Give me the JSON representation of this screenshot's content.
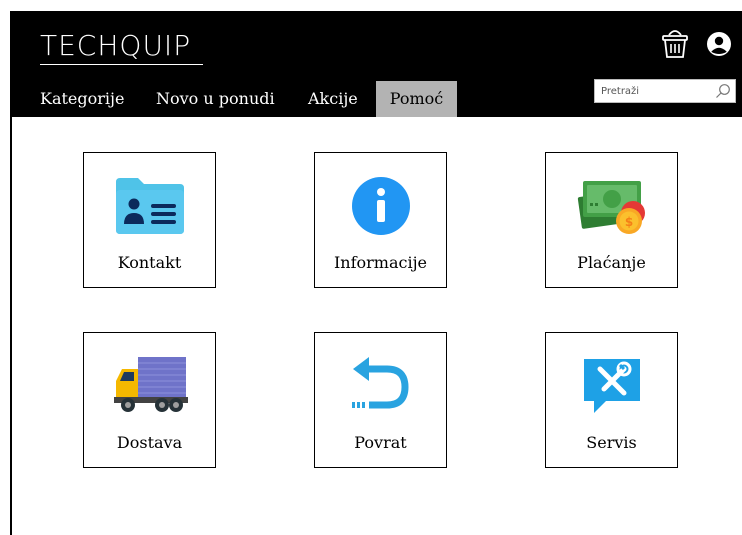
{
  "header": {
    "logo": "TECHQUIP",
    "search_placeholder": "Pretraži"
  },
  "nav": {
    "items": [
      {
        "label": "Kategorije",
        "active": false
      },
      {
        "label": "Novo u ponudi",
        "active": false
      },
      {
        "label": "Akcije",
        "active": false
      },
      {
        "label": "Pomoć",
        "active": true
      }
    ]
  },
  "help_cards": [
    {
      "label": "Kontakt",
      "icon": "contact-card-icon"
    },
    {
      "label": "Informacije",
      "icon": "info-icon"
    },
    {
      "label": "Plaćanje",
      "icon": "money-icon"
    },
    {
      "label": "Dostava",
      "icon": "delivery-truck-icon"
    },
    {
      "label": "Povrat",
      "icon": "return-arrow-icon"
    },
    {
      "label": "Servis",
      "icon": "service-tools-icon"
    }
  ],
  "colors": {
    "header_bg": "#000000",
    "active_tab": "#b3b3b3",
    "info_blue": "#2196f3",
    "contact_blue": "#4fc3e8",
    "money_green": "#4caf50",
    "truck_yellow": "#f5b800",
    "truck_cargo": "#6f73c9",
    "return_blue": "#29a3e0",
    "service_blue": "#1ea1e6"
  }
}
